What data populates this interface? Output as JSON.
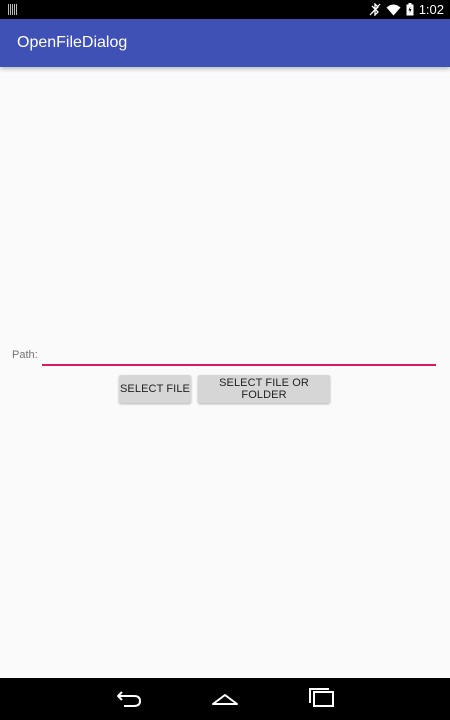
{
  "status_bar": {
    "time": "1:02",
    "icons": [
      "notification-icon",
      "bluetooth-icon",
      "wifi-icon",
      "battery-icon"
    ]
  },
  "app_bar": {
    "title": "OpenFileDialog",
    "color": "#3f51b5"
  },
  "form": {
    "path_label": "Path:",
    "path_value": "",
    "accent_color": "#d81b60"
  },
  "buttons": {
    "select_file": "SELECT FILE",
    "select_file_or_folder": "SELECT FILE OR FOLDER"
  },
  "nav_bar": {
    "icons": [
      "back-icon",
      "home-icon",
      "recents-icon"
    ]
  }
}
